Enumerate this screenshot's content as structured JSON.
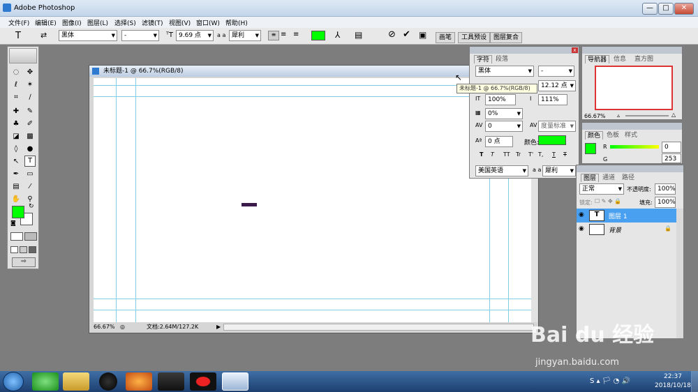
{
  "window": {
    "title": "Adobe Photoshop",
    "min": "—",
    "max": "□",
    "close": "✕"
  },
  "menu": [
    "文件(F)",
    "编辑(E)",
    "图像(I)",
    "图层(L)",
    "选择(S)",
    "滤镜(T)",
    "视图(V)",
    "窗口(W)",
    "帮助(H)"
  ],
  "options": {
    "font_family": "黑体",
    "font_style": "-",
    "size": "9.69 点",
    "aa_label": "a a",
    "aa": "犀利",
    "text_color": "#00ff00",
    "tabs": [
      "画笔",
      "工具预设",
      "图层复合"
    ]
  },
  "document": {
    "title": "未标题-1 @ 66.7%(RGB/8)",
    "zoom": "66.67%",
    "info": "文档:2.64M/127.2K"
  },
  "tooltip": "未标题-1 @ 66.7%(RGB/8)",
  "char_panel": {
    "tabs": [
      "字符",
      "段落"
    ],
    "font_family": "黑体",
    "font_style": "-",
    "leading": "12.12 点",
    "scale_v": "100%",
    "scale_h": "111%",
    "tracking_pct": "0%",
    "kerning": "0",
    "kerning_mode": "度量标准",
    "baseline": "0 点",
    "color_label": "颜色:",
    "color": "#00ff00",
    "styles": [
      "T",
      "T",
      "TT",
      "Tr",
      "T'",
      "T,",
      "T",
      "T"
    ],
    "language": "美国英语",
    "aa_label": "a a",
    "aa": "犀利"
  },
  "nav_panel": {
    "tabs": [
      "导航器",
      "信息",
      "直方图"
    ],
    "zoom": "66.67%"
  },
  "color_panel": {
    "tabs": [
      "颜色",
      "色板",
      "样式"
    ],
    "r_label": "R",
    "r": "0",
    "g_label": "G",
    "g": "253",
    "fg": "#00ff00"
  },
  "layers_panel": {
    "tabs": [
      "图层",
      "通道",
      "路径"
    ],
    "blend": "正常",
    "opacity_label": "不透明度:",
    "opacity": "100%",
    "lock_label": "锁定:",
    "fill_label": "填充:",
    "fill": "100%",
    "layers": [
      {
        "name": "图层 1",
        "type": "T",
        "selected": true
      },
      {
        "name": "背景",
        "type": "",
        "selected": false
      }
    ]
  },
  "taskbar": {
    "time": "22:37",
    "date": "2018/10/18"
  },
  "watermark": {
    "brand": "Bai du 经验",
    "url": "jingyan.baidu.com"
  }
}
